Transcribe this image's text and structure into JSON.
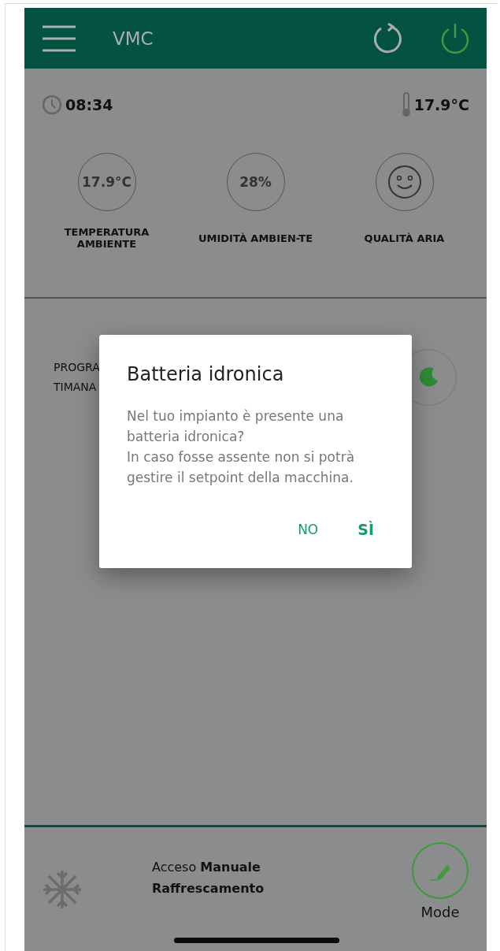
{
  "header": {
    "title": "VMC"
  },
  "info": {
    "time": "08:34",
    "temperature": "17.9°C"
  },
  "gauges": [
    {
      "kind": "text",
      "value": "17.9°C",
      "label": "TEMPERATURA AMBIENTE"
    },
    {
      "kind": "text",
      "value": "28%",
      "label": "UMIDITÀ AMBIEN-TE"
    },
    {
      "kind": "smiley",
      "label": "QUALITÀ ARIA"
    }
  ],
  "program": {
    "lines": [
      "PROGRA",
      "TIMANA"
    ]
  },
  "dialog": {
    "title": "Batteria idronica",
    "message": [
      "Nel tuo impianto è presente una batteria idronica?",
      "In caso fosse assente non si potrà gestire il setpoint della macchina."
    ],
    "buttons": [
      {
        "label": "NO",
        "primary": false
      },
      {
        "label": "SÌ",
        "primary": true
      }
    ]
  },
  "status": {
    "lines": [
      "Acceso **Manuale**",
      "Raffrescamento"
    ],
    "mode_label": "Mode"
  }
}
